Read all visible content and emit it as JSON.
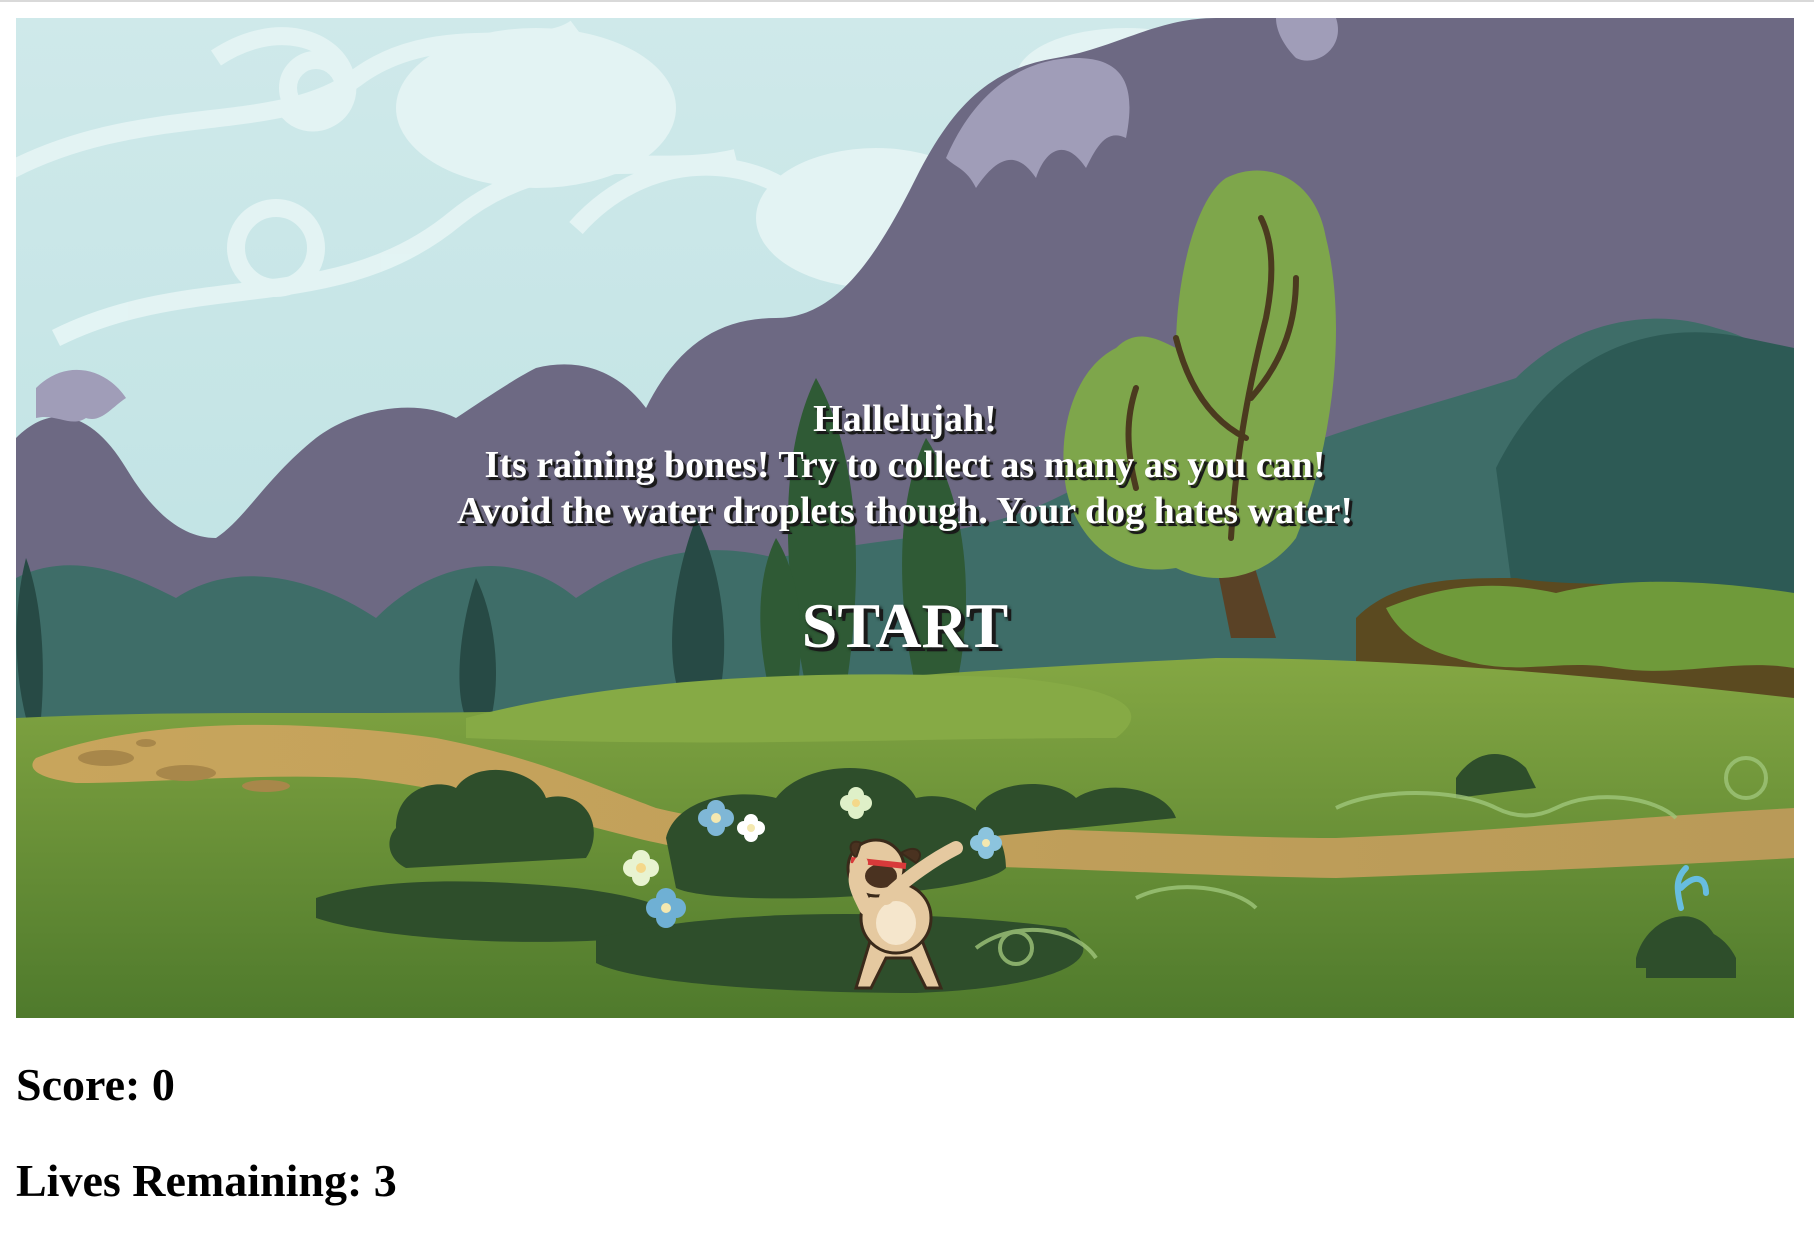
{
  "game": {
    "intro_line1": "Hallelujah!",
    "intro_line2": "Its raining bones! Try to collect as many as you can!",
    "intro_line3": "Avoid the water droplets though. Your dog hates water!",
    "start_label": "START"
  },
  "hud": {
    "score_label": "Score: 0",
    "lives_label": "Lives Remaining: 3"
  },
  "state": {
    "score": 0,
    "lives": 3
  },
  "colors": {
    "sky": "#bfe3e3",
    "mountain": "#6e6a85",
    "mountain_snow": "#9f9cb6",
    "far_hills": "#3f6f6a",
    "grass": "#6e9a3c",
    "path": "#c9a962",
    "bush": "#2f4f2a",
    "tree": "#7fa34a",
    "text": "#ffffff"
  },
  "icons": {
    "player": "pug-dog-icon",
    "flowers": "flower-icon",
    "sprout": "water-sprout-icon"
  }
}
